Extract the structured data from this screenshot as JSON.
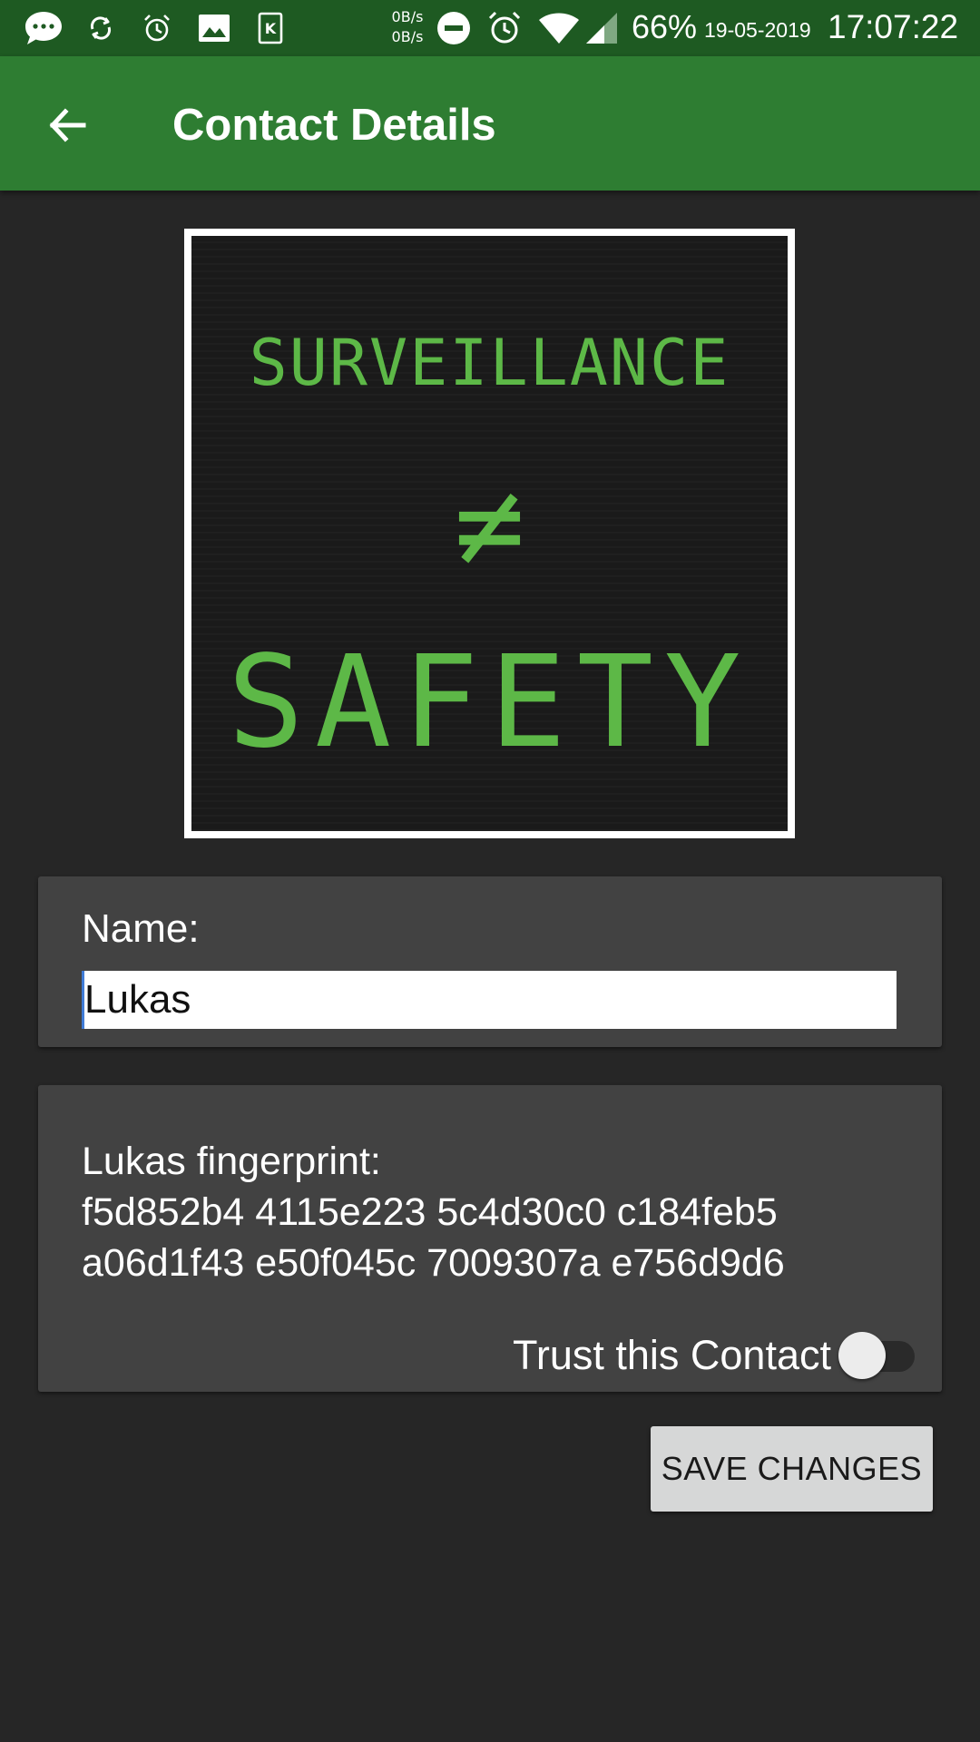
{
  "status_bar": {
    "network_up": "0B/s",
    "network_down": "0B/s",
    "battery": "66%",
    "date": "19-05-2019",
    "time": "17:07:22",
    "icons": [
      "chat-bubble-icon",
      "sync-icon",
      "alarm-icon",
      "image-icon",
      "k-app-icon",
      "do-not-disturb-icon",
      "alarm-icon",
      "wifi-icon",
      "signal-icon"
    ]
  },
  "app_bar": {
    "title": "Contact Details",
    "back_icon": "arrow-back-icon",
    "color": "#2e7d32"
  },
  "avatar": {
    "line1": "SURVEILLANCE",
    "line2": "≠",
    "line3": "SAFETY",
    "text_color": "#5db847"
  },
  "name_card": {
    "label": "Name:",
    "value": "Lukas"
  },
  "fingerprint_card": {
    "label": "Lukas fingerprint:",
    "line1": "f5d852b4 4115e223 5c4d30c0 c184feb5",
    "line2": "a06d1f43 e50f045c 7009307a e756d9d6",
    "trust_label": "Trust this Contact",
    "trust_enabled": false
  },
  "save_button": {
    "label": "SAVE CHANGES"
  }
}
